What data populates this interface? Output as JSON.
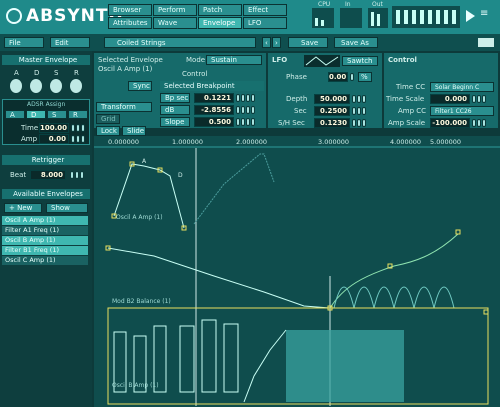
{
  "app": {
    "logo": "ABSYNTH"
  },
  "top_nav": {
    "browser": "Browser",
    "attributes": "Attributes",
    "perform": "Perform",
    "wave": "Wave",
    "patch": "Patch",
    "envelope": "Envelope",
    "effect": "Effect",
    "lfo": "LFO",
    "cpu": "CPU",
    "in": "In",
    "out": "Out"
  },
  "toolbar": {
    "file": "File",
    "edit": "Edit",
    "preset": "Coiled Strings",
    "save": "Save",
    "save_as": "Save As"
  },
  "master_envelope": {
    "title": "Master Envelope",
    "adsr": [
      "A",
      "D",
      "S",
      "R"
    ],
    "adsr_assign": "ADSR Assign",
    "tabs": [
      "A",
      "D",
      "S",
      "R"
    ],
    "time_label": "Time",
    "time_value": "100.00",
    "amp_label": "Amp",
    "amp_value": "0.00"
  },
  "retrigger": {
    "title": "Retrigger",
    "beat_label": "Beat",
    "beat_value": "8.000"
  },
  "available_envelopes": {
    "title": "Available Envelopes",
    "new_label": "+ New",
    "show_label": "Show",
    "items": [
      "Oscil A Amp (1)",
      "Filter A1 Freq (1)",
      "Oscil B Amp (1)",
      "Filter B1 Freq (1)",
      "Oscil C Amp (1)"
    ]
  },
  "selected_envelope": {
    "title": "Selected Envelope",
    "name": "Oscil A Amp (1)",
    "mode_label": "Mode",
    "mode_value": "Sustain",
    "control_label": "Control",
    "sync_label": "Sync",
    "breakpoint_title": "Selected Breakpoint",
    "bp_sec_label": "Bp sec",
    "bp_sec_value": "0.1221",
    "db_label": "dB",
    "db_value": "-2.8556",
    "slope_label": "Slope",
    "slope_value": "0.500"
  },
  "lfo": {
    "title": "LFO",
    "wave_label": "Sawtch",
    "phase_label": "Phase",
    "phase_value": "0.00",
    "phase_unit": "%",
    "depth_label": "Depth",
    "depth_value": "50.000",
    "sec_label": "Sec",
    "sec_value": "0.2500",
    "shift_label": "S/H Sec",
    "shift_value": "0.1230"
  },
  "control": {
    "title": "Control",
    "time_cc_label": "Time CC",
    "time_cc_value": "Solar Beginn C",
    "time_scale_label": "Time Scale",
    "time_scale_value": "0.000",
    "amp_cc_label": "Amp CC",
    "amp_cc_value": "Filter1 CC26",
    "amp_scale_label": "Amp Scale",
    "amp_scale_value": "-100.000"
  },
  "edit_tools": {
    "transform": "Transform",
    "grid": "Grid",
    "lock": "Lock",
    "slide": "Slide"
  },
  "timeline": {
    "ticks": [
      "0.000000",
      "1.000000",
      "2.000000",
      "3.000000",
      "4.000000",
      "5.000000"
    ]
  },
  "envelope_labels": {
    "osc_a": "Oscil A Amp (1)",
    "mod_b2": "Mod B2 Balance (1)",
    "osc_b": "Oscil B Amp (1)",
    "point_a": "A",
    "point_d": "D"
  }
}
